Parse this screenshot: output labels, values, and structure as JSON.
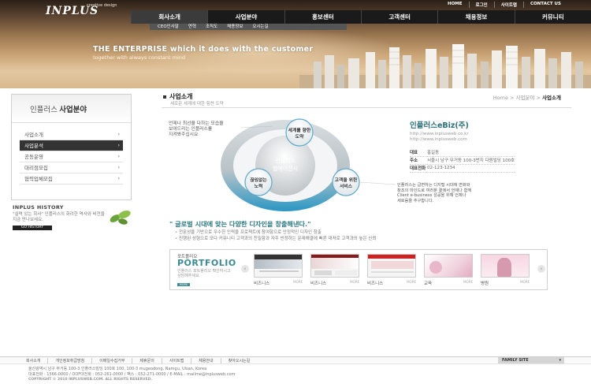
{
  "header": {
    "logo": "INPLUS",
    "logo_sub": "creative design",
    "util_nav": [
      "HOME",
      "로그인",
      "사이트맵",
      "CONTACT US"
    ],
    "gnb": [
      "회사소개",
      "사업분야",
      "홍보센터",
      "고객센터",
      "채용정보",
      "커뮤니티"
    ],
    "subgnb": [
      "CEO인사말",
      "연혁",
      "조직도",
      "채용정보",
      "오시는길"
    ],
    "slogan": "THE ENTERPRISE which it does with the customer",
    "slogan_sub": "together with always constant mind"
  },
  "sidebar": {
    "title_pre": "인플러스",
    "title_main": "사업분야",
    "menu": [
      "사업소개",
      "사업분석",
      "공동운영",
      "대리점모집",
      "협력업체모집"
    ],
    "active_index": 1,
    "history_title": "INPLUS HISTORY",
    "history_text": "\"실력 있는 회사\" 인플러스의 화려한 역사와 비전을 지금 만나보세요.",
    "history_button": "GO HISTORY"
  },
  "content": {
    "title": "사업소개",
    "desc": "세로운 세계에 대한 힘찬 도약",
    "breadcrumb": [
      "Home",
      "사업분야"
    ],
    "breadcrumb_current": "사업소개",
    "diagram": {
      "center_line1": "인플러스",
      "center_line2": "웹에이전시",
      "node_top_1": "세계를 향한",
      "node_top_2": "도약",
      "node_left_1": "끊임없는",
      "node_left_2": "노력",
      "node_right_1": "고객을 위한",
      "node_right_2": "서비스",
      "note_left_1": "언제나 최선을 다하는 모습을",
      "note_left_2": "보여드리는 인플러스를",
      "note_left_3": "지켜봐주십시요",
      "note_right_1": "인플러스는 급변하는 디지털 시대에 변화와",
      "note_right_2": "창조의 마인드로 여러분 곁에서 언제나 함께",
      "note_right_3": "Client e-business 성공을 위해 언제나",
      "note_right_4": "세로움을 추구합니다."
    },
    "company": {
      "name": "인플러스eBiz(주)",
      "url1": "http://www.inplusweb.co.kr",
      "url2": "http://www.inplusweb.com",
      "rows": [
        {
          "k": "대표",
          "v": "홍길동"
        },
        {
          "k": "주소",
          "v": "서울시 남구 무거동 100-3번지 다원빌딩 100호"
        },
        {
          "k": "대표전화",
          "v": "02-123-1234"
        }
      ]
    },
    "headline": "\" 글로벌 시대에 맞는 다양한 디자인을 창출해낸다.\"",
    "bullets": [
      "전문성을 기반으로 우수한 인력을 프로젝트에 참여함으로 안정적인 디자인 창출",
      "진행된 성형으로 모다 커뮤니티 고객과의 친밀함과 자주 빈정하는 문제해결에 빠른 대처로 고객과의 높은 신뢰"
    ],
    "portfolio": {
      "label_small": "포트폴리오",
      "label": "PORTFOLIO",
      "desc": "인플러스 포트폴리오 확인하시고 상담해주세요",
      "more": "MORE",
      "items": [
        {
          "cap": "비즈니스",
          "more": "MORE"
        },
        {
          "cap": "비즈니스",
          "more": "MORE"
        },
        {
          "cap": "비즈니스",
          "more": "MORE"
        },
        {
          "cap": "교육",
          "more": "MORE"
        },
        {
          "cap": "병원",
          "more": "MORE"
        }
      ]
    }
  },
  "footer": {
    "links": [
      "회사소개",
      "개인정보취급방침",
      "이메일수집거부",
      "제휴문의",
      "사이트맵",
      "채용안내",
      "찾아오시는길"
    ],
    "family_site": "FAMILY SITE",
    "addr1": "울산광역시 남구 무거동 100-3 인플러스빌딩 100호   100, 100-3 mugeodong, Namgu, Ulsan, Korea",
    "addr2": "대표전화 : 1566-0000  /  OOF대전화 : 052-261-0000  /  팩스 : 052-271-0000  /  E-MAIL : mailme@inplusweb.com",
    "copyright": "COPYRIGHT © 2010 INPLUSWEB.COM. ALL RIGHTS RESERVED."
  },
  "colors": {
    "teal": "#2e7a83",
    "dark": "#1a1a1a",
    "ring_blue": "#2a97c4",
    "ring_grey": "#cfd3d6"
  }
}
